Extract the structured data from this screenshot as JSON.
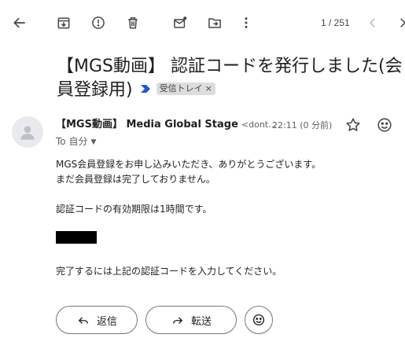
{
  "toolbar": {
    "back_icon": "arrow-left-icon",
    "archive_icon": "archive-icon",
    "spam_icon": "report-spam-icon",
    "delete_icon": "trash-icon",
    "unread_icon": "mark-unread-icon",
    "move_icon": "move-to-folder-icon",
    "more_icon": "more-vertical-icon",
    "pager": "1 / 251",
    "prev_icon": "chevron-left-icon",
    "next_icon": "chevron-right-icon"
  },
  "email": {
    "subject": "【MGS動画】 認証コードを発行しました(会員登録用)",
    "label": "受信トレイ",
    "label_remove": "×",
    "sender_name": "【MGS動画】 Media Global Stage",
    "sender_email": "<dont...",
    "time": "22:11 (0 分前)",
    "to": "To 自分",
    "body": {
      "line1": "MGS会員登録をお申し込みいただき、ありがとうございます。",
      "line2": "まだ会員登録は完了しておりません。",
      "line3": "認証コードの有効期限は1時間です。",
      "line4": "完了するには上記の認証コードを入力してください。"
    }
  },
  "actions": {
    "reply_label": "返信",
    "forward_label": "転送"
  },
  "colors": {
    "importance_marker": "#1a56db",
    "chip_bg": "#dddddd",
    "text": "#202124"
  }
}
